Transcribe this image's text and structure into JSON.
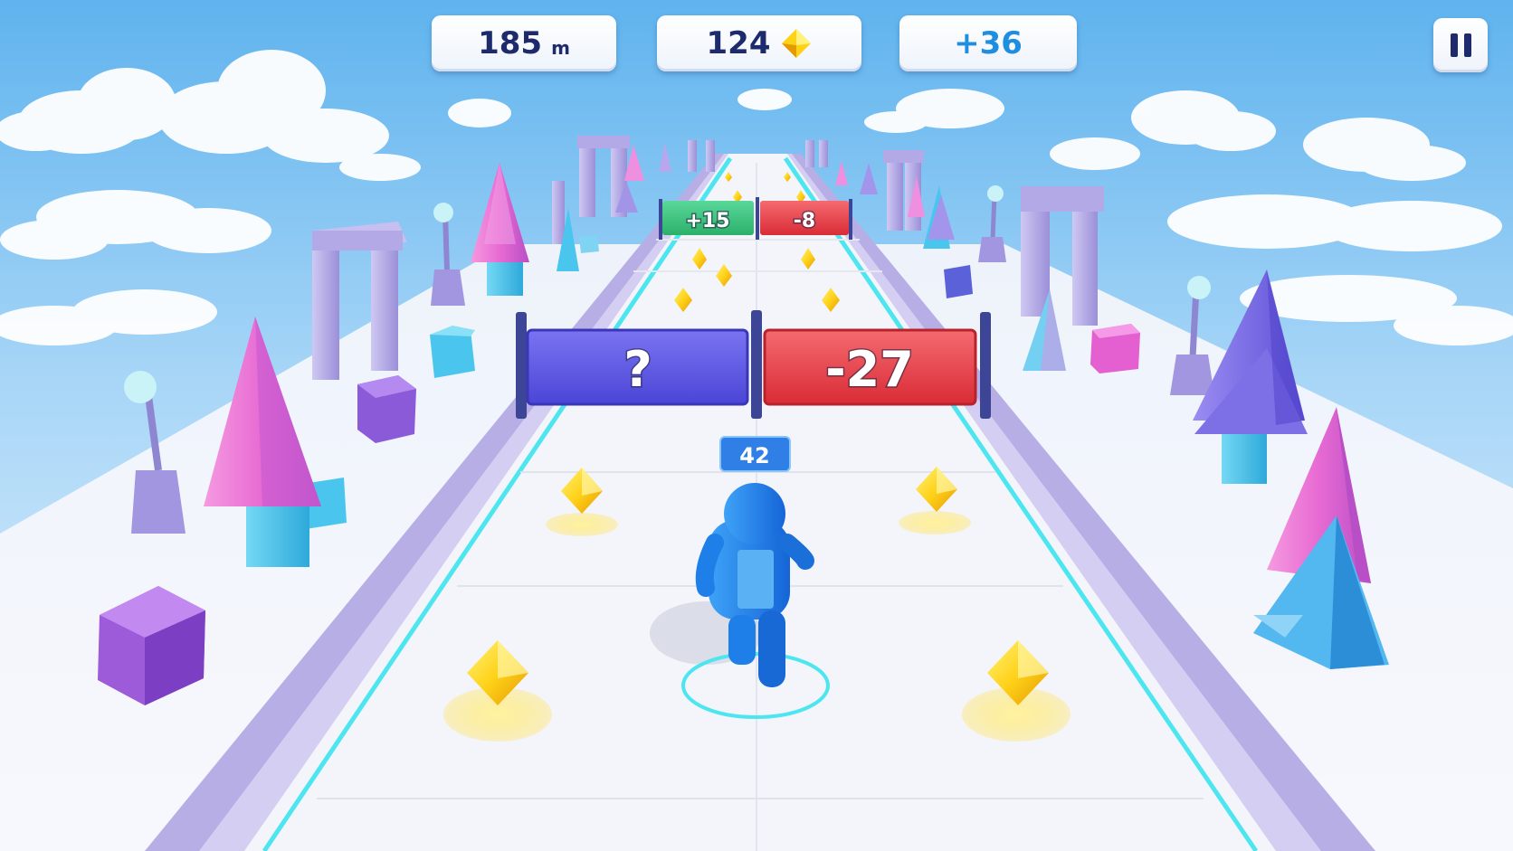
{
  "hud": {
    "distance_value": "185",
    "distance_unit": "m",
    "gems_count": "124",
    "gem_icon": "diamond-icon",
    "bonus": "+36",
    "pause_icon": "pause-icon"
  },
  "gates": {
    "near_left": "?",
    "near_right": "-27",
    "far_left": "+15",
    "far_right": "-8"
  },
  "player": {
    "count": "42"
  },
  "colors": {
    "sky_top": "#5fb3ee",
    "track": "#f4f5fb",
    "rail": "#b7aee6",
    "neon_line": "#4de6f0",
    "gate_blue": "#5a55e6",
    "gate_red": "#e83b43",
    "gate_green": "#3cc47c",
    "player": "#1f7fe8",
    "gem": "#ffd21a"
  }
}
